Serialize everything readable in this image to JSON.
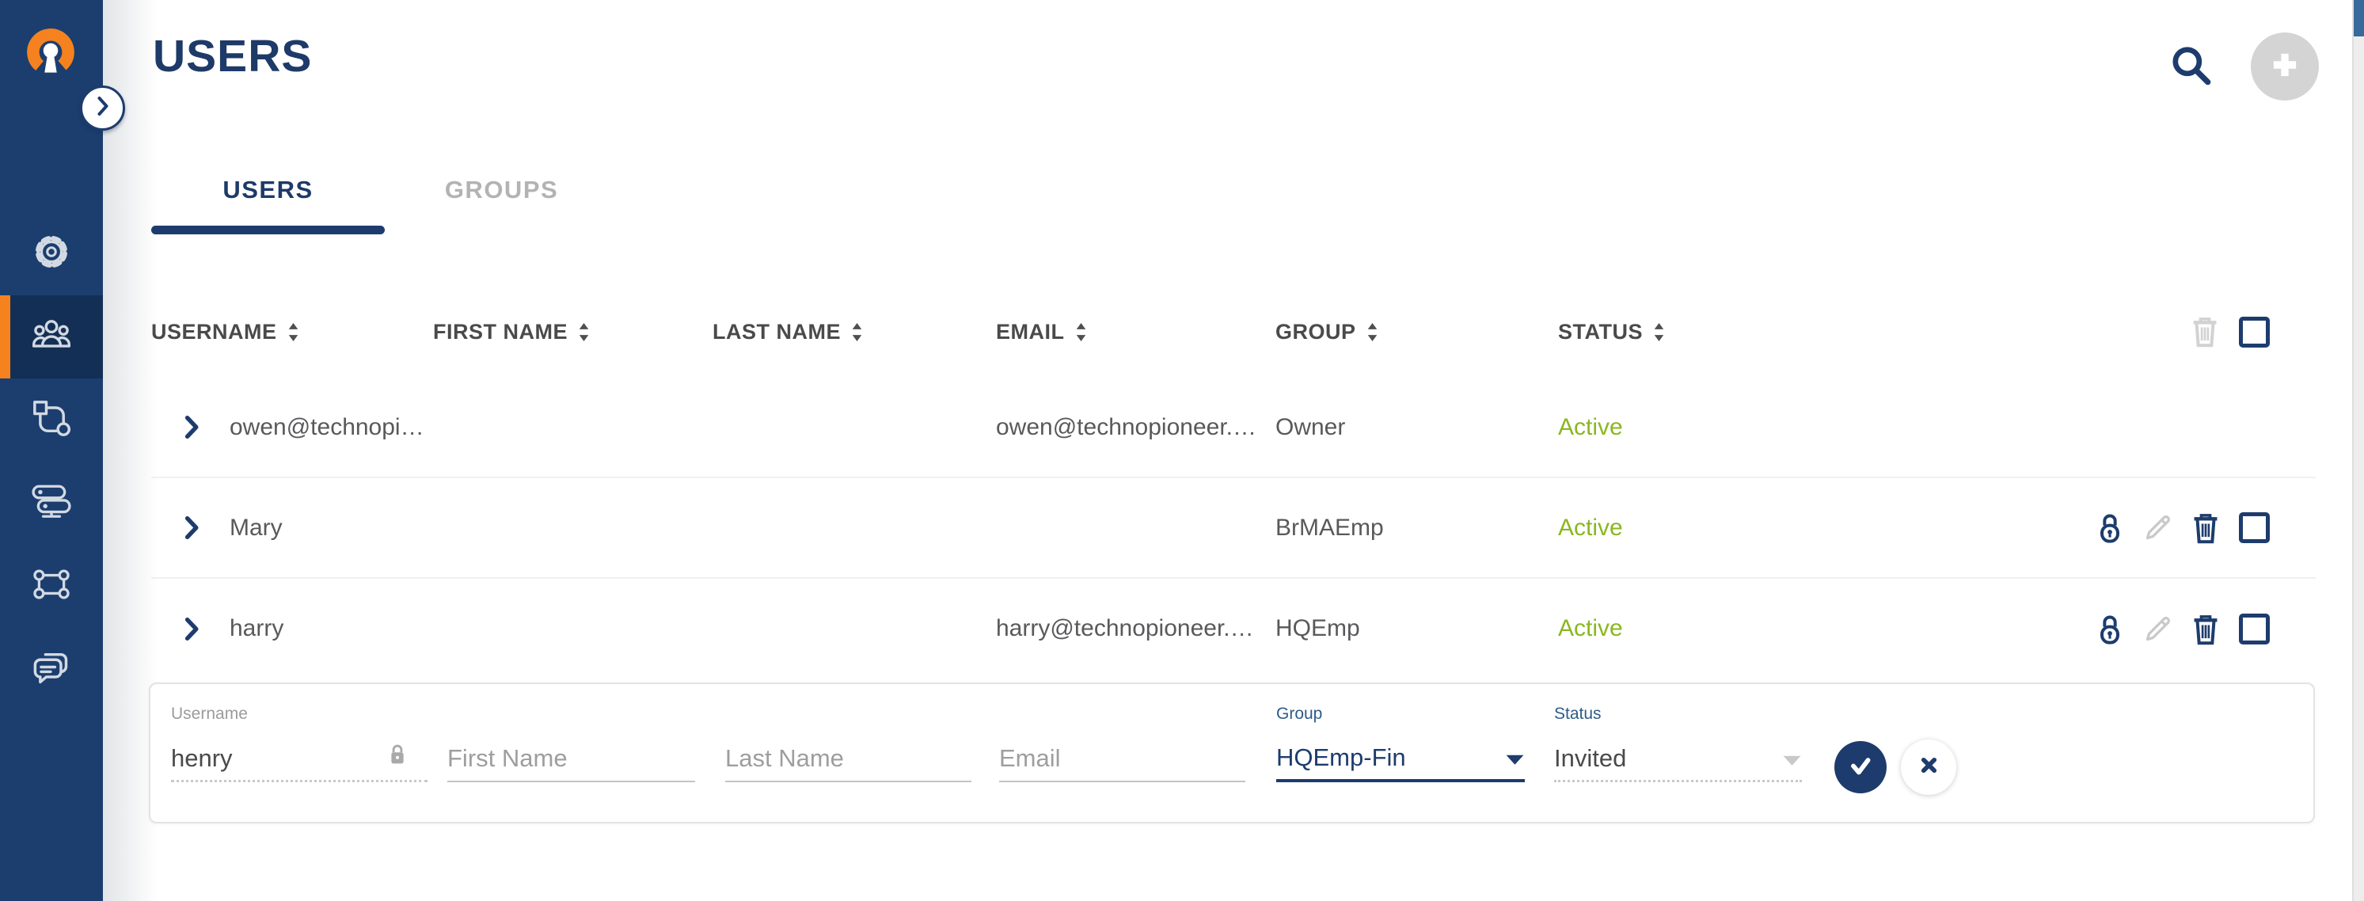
{
  "colors": {
    "accent_orange": "#f5821f",
    "navy": "#1d3c6d",
    "status_active_green": "#8ab720"
  },
  "sidebar": {
    "logo_icon": "openvpn-logo",
    "expand_icon": "chevron-right-icon",
    "items": [
      {
        "id": "settings",
        "icon": "gear-icon",
        "active": false
      },
      {
        "id": "users",
        "icon": "users-icon",
        "active": true
      },
      {
        "id": "objects",
        "icon": "shapes-icon",
        "active": false
      },
      {
        "id": "servers",
        "icon": "server-icon",
        "active": false
      },
      {
        "id": "network",
        "icon": "network-nodes-icon",
        "active": false
      },
      {
        "id": "support",
        "icon": "chat-icon",
        "active": false
      }
    ]
  },
  "page": {
    "title": "USERS"
  },
  "toolbar": {
    "search_icon": "search-icon",
    "add_icon": "plus-icon",
    "add_enabled": false
  },
  "tabs": [
    {
      "label": "USERS",
      "active": true
    },
    {
      "label": "GROUPS",
      "active": false
    }
  ],
  "table": {
    "columns": [
      {
        "label": "USERNAME",
        "sortable": true
      },
      {
        "label": "FIRST NAME",
        "sortable": true
      },
      {
        "label": "LAST NAME",
        "sortable": true
      },
      {
        "label": "EMAIL",
        "sortable": true
      },
      {
        "label": "GROUP",
        "sortable": true
      },
      {
        "label": "STATUS",
        "sortable": true
      }
    ],
    "header_actions": [
      "delete-icon-disabled",
      "select-all-checkbox"
    ],
    "row_action_icons": [
      "lock-icon",
      "edit-icon-disabled",
      "delete-icon",
      "row-checkbox"
    ],
    "rows": [
      {
        "username": "owen@technopi…",
        "first_name": "",
        "last_name": "",
        "email": "owen@technopioneer.…",
        "group": "Owner",
        "status": "Active",
        "has_actions": false
      },
      {
        "username": "Mary",
        "first_name": "",
        "last_name": "",
        "email": "",
        "group": "BrMAEmp",
        "status": "Active",
        "has_actions": true
      },
      {
        "username": "harry",
        "first_name": "",
        "last_name": "",
        "email": "harry@technopioneer.…",
        "group": "HQEmp",
        "status": "Active",
        "has_actions": true
      }
    ]
  },
  "edit_row": {
    "username": {
      "label": "Username",
      "value": "henry",
      "locked": true
    },
    "first_name": {
      "placeholder": "First Name",
      "value": ""
    },
    "last_name": {
      "placeholder": "Last Name",
      "value": ""
    },
    "email": {
      "placeholder": "Email",
      "value": ""
    },
    "group": {
      "label": "Group",
      "value": "HQEmp-Fin"
    },
    "status": {
      "label": "Status",
      "value": "Invited",
      "disabled": true
    },
    "confirm_icon": "check-icon",
    "cancel_icon": "close-icon"
  }
}
